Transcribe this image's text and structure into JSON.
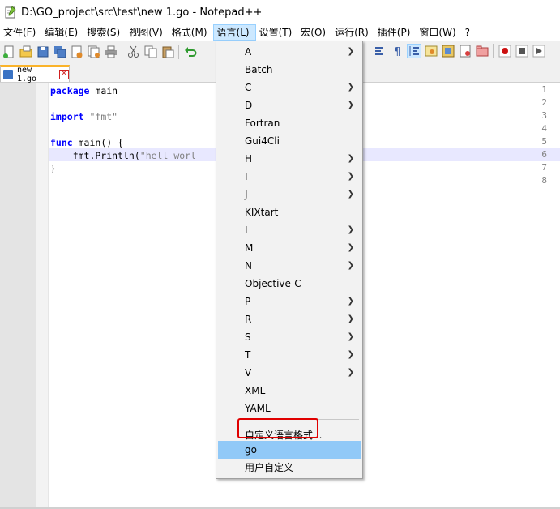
{
  "window": {
    "title": "D:\\GO_project\\src\\test\\new 1.go - Notepad++"
  },
  "menubar": [
    "文件(F)",
    "编辑(E)",
    "搜索(S)",
    "视图(V)",
    "格式(M)",
    "语言(L)",
    "设置(T)",
    "宏(O)",
    "运行(R)",
    "插件(P)",
    "窗口(W)",
    "?"
  ],
  "tab": {
    "label": "new 1.go"
  },
  "editor": {
    "line_numbers": [
      "1",
      "2",
      "3",
      "4",
      "5",
      "6",
      "7",
      "8"
    ],
    "lines": [
      {
        "kw": "package",
        "rest": " main"
      },
      {
        "kw": "",
        "rest": ""
      },
      {
        "kw": "import",
        "rest": " ",
        "str": "\"fmt\""
      },
      {
        "kw": "",
        "rest": ""
      },
      {
        "kw": "func",
        "rest": " main() {"
      },
      {
        "kw": "",
        "rest": "    fmt.Println(",
        "str": "\"hell worl"
      },
      {
        "kw": "",
        "rest": "}"
      },
      {
        "kw": "",
        "rest": ""
      }
    ]
  },
  "language_menu": {
    "items": [
      {
        "label": "A",
        "submenu": true
      },
      {
        "label": "Batch",
        "submenu": false
      },
      {
        "label": "C",
        "submenu": true
      },
      {
        "label": "D",
        "submenu": true
      },
      {
        "label": "Fortran",
        "submenu": false
      },
      {
        "label": "Gui4Cli",
        "submenu": false
      },
      {
        "label": "H",
        "submenu": true
      },
      {
        "label": "I",
        "submenu": true
      },
      {
        "label": "J",
        "submenu": true
      },
      {
        "label": "KIXtart",
        "submenu": false
      },
      {
        "label": "L",
        "submenu": true
      },
      {
        "label": "M",
        "submenu": true
      },
      {
        "label": "N",
        "submenu": true
      },
      {
        "label": "Objective-C",
        "submenu": false
      },
      {
        "label": "P",
        "submenu": true
      },
      {
        "label": "R",
        "submenu": true
      },
      {
        "label": "S",
        "submenu": true
      },
      {
        "label": "T",
        "submenu": true
      },
      {
        "label": "V",
        "submenu": true
      },
      {
        "label": "XML",
        "submenu": false
      },
      {
        "label": "YAML",
        "submenu": false
      }
    ],
    "define_language": "自定义语言格式...",
    "go": "go",
    "user_defined": "用户自定义"
  },
  "colors": {
    "highlight": "#91c9f7",
    "annotation": "#e00000",
    "keyword": "#0000ff"
  }
}
